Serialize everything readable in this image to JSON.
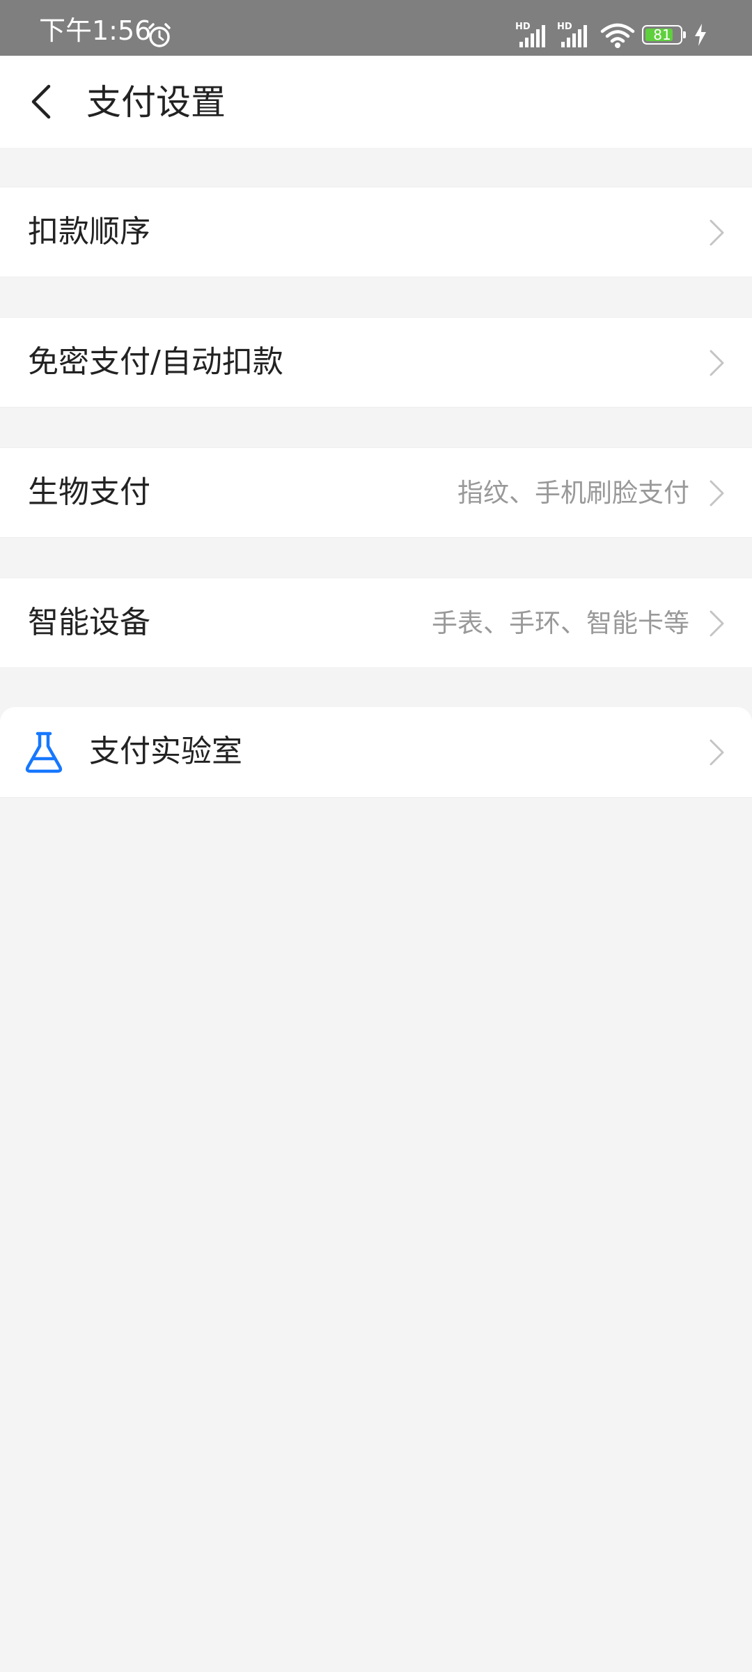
{
  "status_bar": {
    "time": "下午1:56",
    "signal1_label": "HD",
    "signal2_label": "HD",
    "battery_level": "81",
    "battery_fraction": 0.81,
    "icons": [
      "alarm-icon",
      "signal-icon",
      "wifi-icon",
      "battery-icon",
      "charging-icon"
    ]
  },
  "header": {
    "back_icon": "chevron-left-icon",
    "title": "支付设置"
  },
  "settings": {
    "deduction_order": {
      "label": "扣款顺序"
    },
    "password_free": {
      "label": "免密支付/自动扣款"
    },
    "biometric": {
      "label": "生物支付",
      "value": "指纹、手机刷脸支付"
    },
    "smart_devices": {
      "label": "智能设备",
      "value": "手表、手环、智能卡等"
    },
    "payment_lab": {
      "label": "支付实验室",
      "icon": "flask-icon"
    }
  },
  "colors": {
    "background": "#f4f4f4",
    "status_bar": "#7f7f7f",
    "accent_blue": "#1677ff",
    "battery_green": "#5fd03d",
    "secondary_text": "#999999"
  }
}
